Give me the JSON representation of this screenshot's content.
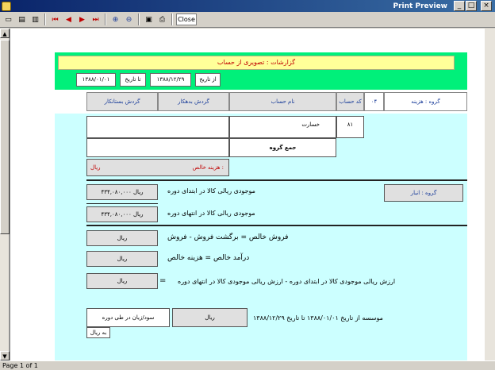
{
  "window": {
    "title": "Print Preview",
    "minimize": "_",
    "maximize": "□",
    "close": "×"
  },
  "toolbar": {
    "buttons": [
      "first-page",
      "prev-page",
      "next-page",
      "last-page",
      "zoom-in",
      "zoom-out",
      "save",
      "print"
    ],
    "close_label": "Close"
  },
  "status": {
    "page_text": "Page 1 of 1"
  },
  "report": {
    "banner": "گزارشات : تصویری از حساب",
    "param_boxes": [
      "۱۳۸۸/۰۱/۰۱",
      "تا تاریخ",
      "۱۳۸۸/۱۲/۲۹",
      "از تاریخ"
    ],
    "header": {
      "group_label": "گروه : هزینه",
      "group_code": "۰۴",
      "acc_code": "کد حساب",
      "acc_name": "نام حساب",
      "debit": "گردش بدهکار",
      "credit": "گردش بستانکار"
    },
    "row1": {
      "code": "۸۱",
      "name": "خسارت"
    },
    "row2": {
      "name": "جمع گروه"
    },
    "net_cost_label": "هزینه خالص :",
    "net_cost_value": "ریال",
    "group2": "گروه : انبار",
    "inv_start_label": "موجودی ریالی کالا در ابتدای دوره",
    "inv_start_value": "۴۳۴,۰۸۰,۰۰۰ ریال",
    "inv_end_label": "موجودی ریالی کالا در انتهای دوره",
    "inv_end_value": "۴۳۴,۰۸۰,۰۰۰ ریال",
    "net_sales_label": "فروش خالص = برگشت فروش - فروش",
    "net_sales_value": "ریال",
    "net_income_label": "درآمد خالص = هزینه خالص",
    "net_income_value": "ریال",
    "formula": "ارزش ریالی موجودی کالا در ابتدای دوره - ارزش ریالی موجودی کالا در انتهای دوره",
    "formula_value": "ریال",
    "equals": "=",
    "period_text": "موسسه از تاریخ ۱۳۸۸/۰۱/۰۱ تا تاریخ ۱۳۸۸/۱۲/۲۹",
    "period_value": "ریال",
    "final_text": "سود/زیان در طی دوره",
    "final_sub": "به ریال"
  }
}
